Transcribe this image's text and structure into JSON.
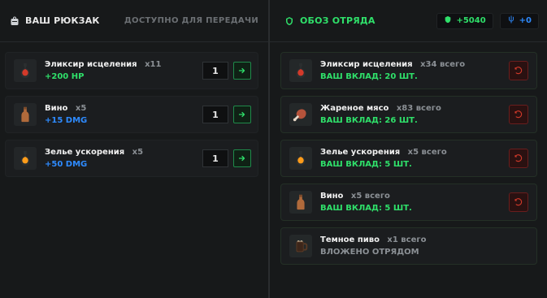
{
  "left": {
    "title": "ВАШ РЮКЗАК",
    "subtitle": "ДОСТУПНО ДЛЯ ПЕРЕДАЧИ",
    "items": [
      {
        "name": "Эликсир исцеления",
        "qty": "x11",
        "stat": "+200 HP",
        "stat_type": "hp",
        "amount": "1",
        "icon": "potion-red-icon"
      },
      {
        "name": "Вино",
        "qty": "x5",
        "stat": "+15 DMG",
        "stat_type": "dmg",
        "amount": "1",
        "icon": "bottle-icon"
      },
      {
        "name": "Зелье ускорения",
        "qty": "x5",
        "stat": "+50 DMG",
        "stat_type": "dmg",
        "amount": "1",
        "icon": "potion-orange-icon"
      }
    ]
  },
  "right": {
    "title": "ОБОЗ ОТРЯДА",
    "pills": [
      {
        "label": "+5040",
        "color": "green",
        "icon": "shield-icon"
      },
      {
        "label": "+0",
        "color": "blue",
        "icon": "trident-icon"
      }
    ],
    "items": [
      {
        "name": "Эликсир исцеления",
        "total": "x34 всего",
        "contrib": "ВАШ ВКЛАД: 20 ШТ.",
        "contrib_state": "active",
        "icon": "potion-red-icon",
        "has_undo": true
      },
      {
        "name": "Жареное мясо",
        "total": "x83 всего",
        "contrib": "ВАШ ВКЛАД: 26 ШТ.",
        "contrib_state": "active",
        "icon": "meat-icon",
        "has_undo": true
      },
      {
        "name": "Зелье ускорения",
        "total": "x5 всего",
        "contrib": "ВАШ ВКЛАД: 5 ШТ.",
        "contrib_state": "active",
        "icon": "potion-orange-icon",
        "has_undo": true
      },
      {
        "name": "Вино",
        "total": "x5 всего",
        "contrib": "ВАШ ВКЛАД: 5 ШТ.",
        "contrib_state": "active",
        "icon": "bottle-icon",
        "has_undo": true
      },
      {
        "name": "Темное пиво",
        "total": "x1 всего",
        "contrib": "ВЛОЖЕНО ОТРЯДОМ",
        "contrib_state": "muted",
        "icon": "beer-mug-icon",
        "has_undo": false
      }
    ]
  },
  "colors": {
    "bg": "#161718",
    "panel": "#17191a",
    "green": "#2fe06a",
    "blue": "#2e8bff",
    "red": "#d33a2a"
  }
}
